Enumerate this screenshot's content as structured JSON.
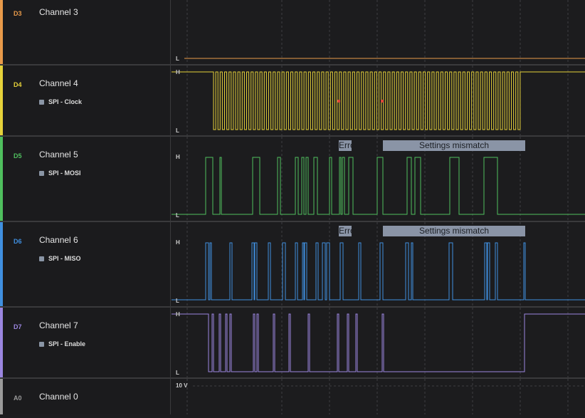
{
  "timeline": {
    "labels": [
      "",
      "",
      "",
      "",
      "",
      "",
      "",
      ""
    ]
  },
  "channels": [
    {
      "id": "D3",
      "name": "Channel 3",
      "color": "#e89a4a",
      "analyzer": "",
      "levels": [
        "L"
      ]
    },
    {
      "id": "D4",
      "name": "Channel 4",
      "color": "#e6d23a",
      "analyzer": "SPI - Clock",
      "levels": [
        "H",
        "L"
      ]
    },
    {
      "id": "D5",
      "name": "Channel 5",
      "color": "#4fbf5e",
      "analyzer": "SPI - MOSI",
      "levels": [
        "H",
        "L"
      ],
      "bubbles": [
        "Erro",
        "Settings mismatch"
      ]
    },
    {
      "id": "D6",
      "name": "Channel 6",
      "color": "#3f8fe0",
      "analyzer": "SPI - MISO",
      "levels": [
        "H",
        "L"
      ],
      "bubbles": [
        "Erro",
        "Settings mismatch"
      ]
    },
    {
      "id": "D7",
      "name": "Channel 7",
      "color": "#9b86e0",
      "analyzer": "SPI - Enable",
      "levels": [
        "H",
        "L"
      ]
    },
    {
      "id": "A0",
      "name": "Channel 0",
      "color": "#9a9a9a",
      "analyzer": "",
      "levels": [
        "10 V"
      ]
    }
  ],
  "colors": {
    "background": "#1c1c1e",
    "grid": "#3e3e42",
    "bubble": "#8a94a6",
    "error_marker": "#e0453a"
  },
  "icons": [
    "analyzer-square-icon",
    "error-marker-icon"
  ]
}
